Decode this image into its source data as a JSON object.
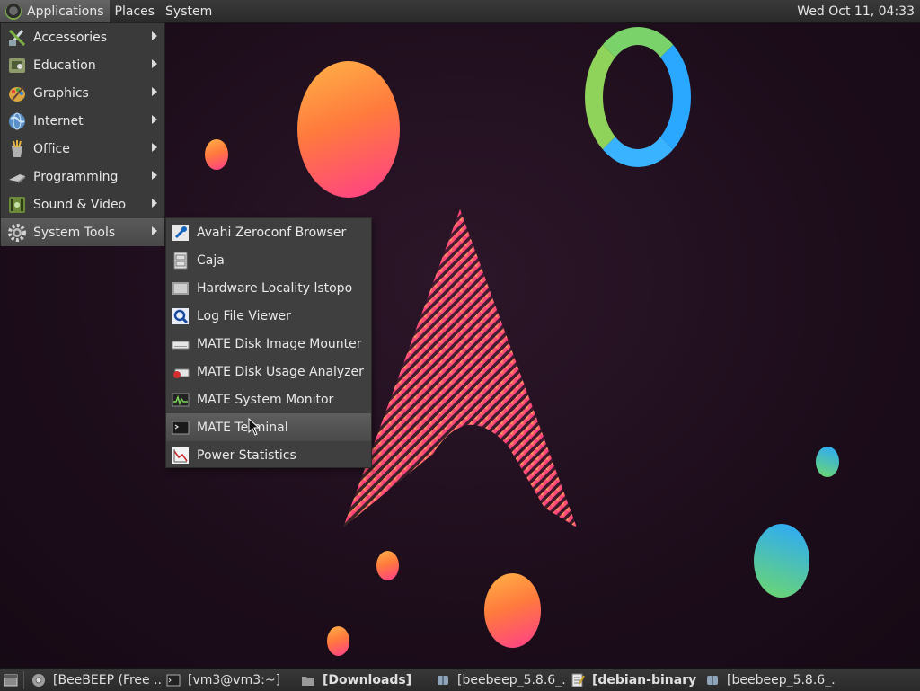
{
  "top_panel": {
    "menus": [
      {
        "label": "Applications",
        "active": true
      },
      {
        "label": "Places"
      },
      {
        "label": "System"
      }
    ],
    "clock": "Wed Oct 11, 04:33"
  },
  "applications_menu": [
    {
      "label": "Accessories",
      "icon": "accessories-icon"
    },
    {
      "label": "Education",
      "icon": "education-icon"
    },
    {
      "label": "Graphics",
      "icon": "graphics-icon"
    },
    {
      "label": "Internet",
      "icon": "internet-globe-icon"
    },
    {
      "label": "Office",
      "icon": "office-icon"
    },
    {
      "label": "Programming",
      "icon": "programming-icon"
    },
    {
      "label": "Sound & Video",
      "icon": "sound-video-icon"
    },
    {
      "label": "System Tools",
      "icon": "system-tools-gear-icon",
      "active": true
    }
  ],
  "system_tools_submenu": [
    {
      "label": "Avahi Zeroconf Browser",
      "icon": "avahi-browser-icon"
    },
    {
      "label": "Caja",
      "icon": "caja-file-manager-icon"
    },
    {
      "label": "Hardware Locality lstopo",
      "icon": "hardware-locality-icon"
    },
    {
      "label": "Log File Viewer",
      "icon": "log-viewer-magnifier-icon"
    },
    {
      "label": "MATE Disk Image Mounter",
      "icon": "disk-image-mounter-icon"
    },
    {
      "label": "MATE Disk Usage Analyzer",
      "icon": "disk-usage-analyzer-icon"
    },
    {
      "label": "MATE System Monitor",
      "icon": "system-monitor-icon"
    },
    {
      "label": "MATE Terminal",
      "icon": "terminal-icon",
      "hover": true
    },
    {
      "label": "Power Statistics",
      "icon": "power-statistics-icon"
    }
  ],
  "taskbar": [
    {
      "label": "[BeeBEEP (Free ...",
      "icon": "chrome-icon",
      "bold": false
    },
    {
      "label": "[vm3@vm3:~]",
      "icon": "terminal-icon",
      "bold": false
    },
    {
      "label": "[Downloads]",
      "icon": "folder-icon",
      "bold": true
    },
    {
      "label": "[beebeep_5.8.6_...",
      "icon": "archive-icon",
      "bold": false
    },
    {
      "label": "[debian-binary (...",
      "icon": "text-editor-icon",
      "bold": true
    },
    {
      "label": "[beebeep_5.8.6_...",
      "icon": "archive-icon",
      "bold": false
    }
  ],
  "colors": {
    "panel": "#2f2f2f",
    "menu_bg": "#3a3a3a",
    "highlight": "#555555",
    "wallpaper": "#1e0f1d"
  }
}
